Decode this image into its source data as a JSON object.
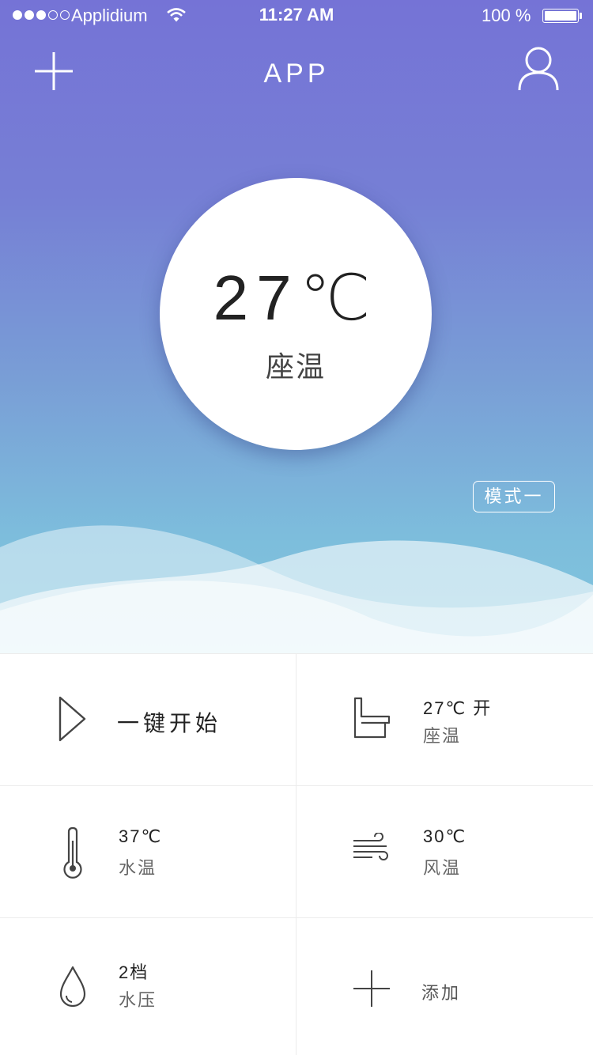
{
  "status_bar": {
    "carrier": "Applidium",
    "time": "11:27 AM",
    "battery": "100 %"
  },
  "nav": {
    "title": "APP",
    "add_icon": "plus-icon",
    "user_icon": "user-icon"
  },
  "hero": {
    "temperature": "27℃",
    "label": "座温",
    "mode": "模式一"
  },
  "grid": {
    "start": {
      "label": "一键开始",
      "icon": "play-icon"
    },
    "seat": {
      "value": "27℃ 开",
      "label": "座温",
      "icon": "toilet-seat-icon"
    },
    "water_temp": {
      "value": "37℃",
      "label": "水温",
      "icon": "thermometer-icon"
    },
    "air_temp": {
      "value": "30℃",
      "label": "风温",
      "icon": "wind-icon"
    },
    "water_pressure": {
      "value": "2档",
      "label": "水压",
      "icon": "water-drop-icon"
    },
    "add": {
      "label": "添加",
      "icon": "plus-icon"
    }
  },
  "colors": {
    "gradient_top": "#7573d6",
    "gradient_bottom": "#80c6de",
    "text_dark": "#222222",
    "divider": "#ececec"
  }
}
